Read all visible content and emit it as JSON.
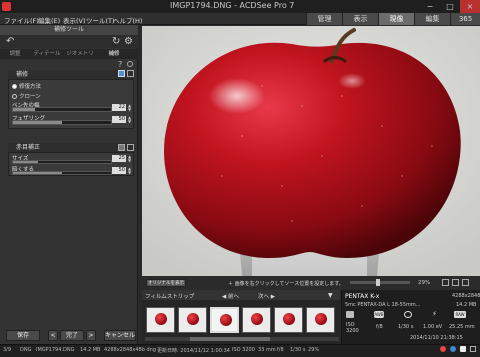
{
  "window": {
    "title": "IMGP1794.DNG - ACDSee Pro 7",
    "min": "−",
    "max": "□",
    "close": "×"
  },
  "menu": {
    "items": [
      "ファイル(F)",
      "編集(E)",
      "表示(V)",
      "ツール(T)",
      "ヘルプ(H)"
    ]
  },
  "modes": {
    "tabs": [
      "管理",
      "表示",
      "現像",
      "編集",
      "365"
    ],
    "active": "現像"
  },
  "left_panel": {
    "title": "補修ツール",
    "subtabs": [
      "調整",
      "ディテール",
      "ジオメトリ",
      "補修"
    ],
    "repair": {
      "header": "補修",
      "radio_options": [
        "修復方法",
        "クローン"
      ],
      "selected": "修復方法",
      "sliders": [
        {
          "label": "ペン先の幅",
          "value": "22",
          "fill": 0.22
        },
        {
          "label": "フェザリング",
          "value": "50",
          "fill": 0.5
        }
      ]
    },
    "redeye": {
      "header": "赤目補正",
      "sliders": [
        {
          "label": "サイズ",
          "value": "25",
          "fill": 0.25
        },
        {
          "label": "暗くする",
          "value": "50",
          "fill": 0.5
        }
      ]
    },
    "buttons": {
      "save": "保存",
      "prev": "<",
      "done": "完了",
      "next": ">",
      "cancel": "キャンセル"
    }
  },
  "viewer": {
    "original_label": "オリジナルを表示",
    "hint": "＋ 画像を右クリックしてソース位置を設定します。",
    "zoom": "29%"
  },
  "filmstrip": {
    "label": "フィルムストリップ",
    "prev": "◀ 前へ",
    "next": "次へ ▶",
    "thumb_count": 6,
    "selected_index": 2
  },
  "info": {
    "camera": "PENTAX K-x",
    "dims": "4288x2848",
    "lens": "5mc PENTAX-DA L 18-55mm...",
    "size": "14.2 MB",
    "iso_label": "ISO",
    "iso": "3200",
    "aperture": "f/8",
    "shutter": "1/30 s",
    "ev": "1.00 eV",
    "focal": "25.25 mm",
    "date": "2014/11/10 21:38:15"
  },
  "status": {
    "counter": "3/9",
    "format": "DNG",
    "filename": "IMGP1794.DNG",
    "filesize": "14.2 MB",
    "dimensions": "4288x2848x48b dng",
    "modified": "更新日時: 2014/11/12 1:00:34",
    "iso": "ISO 3200",
    "focal": "33 mm",
    "aperture": "f/8",
    "shutter": "1/30 s",
    "zoom": "29%"
  },
  "colors": {
    "accent_active": "#6c6c6c",
    "apple_red": "#b0101a",
    "background": "#dcdcdc"
  }
}
